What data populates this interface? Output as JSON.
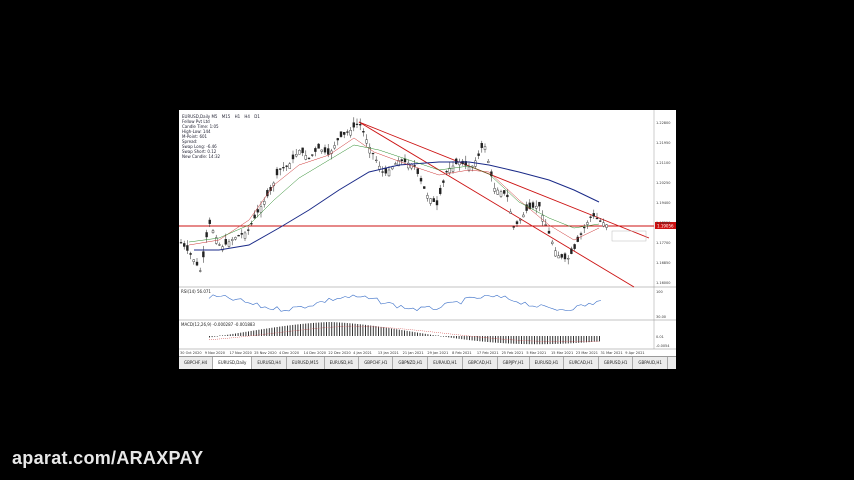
{
  "window": {
    "symbol_line": "EURUSD,Daily",
    "timeframes": [
      "M5",
      "M15",
      "H1",
      "H4",
      "D1"
    ]
  },
  "info_panel": {
    "rows": [
      "Fellow Pvt Ltd",
      "Candle Time: 1:05",
      "High-Low: 144",
      "M-Point: 601",
      "Spread: ",
      "Swap Long: -6.46",
      "Swap Short: 0.12",
      "New Candle: 14:32"
    ]
  },
  "price_axis": [
    "1.22800",
    "1.21950",
    "1.21100",
    "1.20250",
    "1.19400",
    "1.18550",
    "1.17700",
    "1.16850",
    "1.16000"
  ],
  "current_price": "1.19056",
  "rsi_label": "RSI(14) 56.071",
  "rsi_axis": [
    "100",
    "30.00"
  ],
  "macd_label": "MACD(12,26,9) -0.000287 -0.001883",
  "macd_axis": [
    "0.01",
    "-0.0054"
  ],
  "time_axis": [
    "30 Oct 2020",
    "9 Nov 2020",
    "17 Nov 2020",
    "25 Nov 2020",
    "4 Dec 2020",
    "14 Dec 2020",
    "22 Dec 2020",
    "4 Jan 2021",
    "13 Jan 2021",
    "21 Jan 2021",
    "29 Jan 2021",
    "8 Feb 2021",
    "17 Feb 2021",
    "25 Feb 2021",
    "5 Mar 2021",
    "15 Mar 2021",
    "23 Mar 2021",
    "31 Mar 2021",
    "9 Apr 2021"
  ],
  "tabs": [
    "GBPCHF,H4",
    "EURUSD,Daily",
    "EURUSD,H4",
    "EURUSD,M15",
    "EURUSD,H1",
    "GBPCHF,H1",
    "GBPNZD,H1",
    "EURAUD,H1",
    "GBPCAD,H1",
    "GBPJPY,H1",
    "EURUSD,H1",
    "EURCAD,H1",
    "GBPUSD,H1",
    "GBPAUD,H1"
  ],
  "active_tab": 1,
  "watermark": "aparat.com/ARAXPAY",
  "colors": {
    "channel": "#cc1111",
    "ma_slow": "#1a2a88",
    "ma_fast": "#cc3333",
    "ma_mid": "#2a8a2a",
    "rsi": "#3a6fc8",
    "macd_hist": "#333333",
    "macd_signal": "#d24444"
  }
}
